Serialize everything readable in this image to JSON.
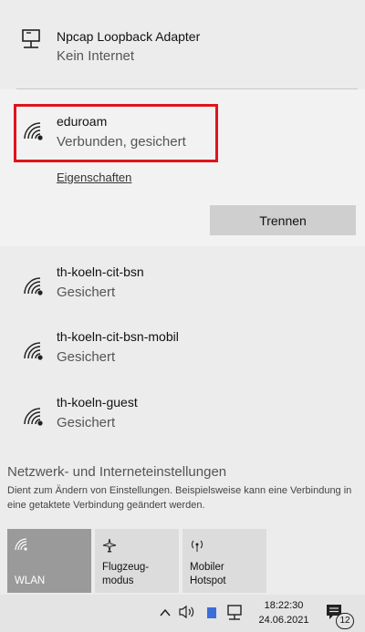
{
  "adapter": {
    "name": "Npcap Loopback Adapter",
    "status": "Kein Internet"
  },
  "connected_network": {
    "name": "eduroam",
    "status": "Verbunden, gesichert",
    "properties_link": "Eigenschaften",
    "disconnect_button": "Trennen"
  },
  "networks": [
    {
      "name": "th-koeln-cit-bsn",
      "status": "Gesichert"
    },
    {
      "name": "th-koeln-cit-bsn-mobil",
      "status": "Gesichert"
    },
    {
      "name": "th-koeln-guest",
      "status": "Gesichert"
    }
  ],
  "settings": {
    "title": "Netzwerk- und Interneteinstellungen",
    "description": "Dient zum Ändern von Einstellungen. Beispielsweise kann eine Verbindung in eine getaktete Verbindung geändert werden."
  },
  "quick_actions": {
    "wlan": "WLAN",
    "airplane": "Flugzeug-\nmodus",
    "hotspot": "Mobiler\nHotspot"
  },
  "taskbar": {
    "time": "18:22:30",
    "date": "24.06.2021",
    "notification_count": "12"
  }
}
